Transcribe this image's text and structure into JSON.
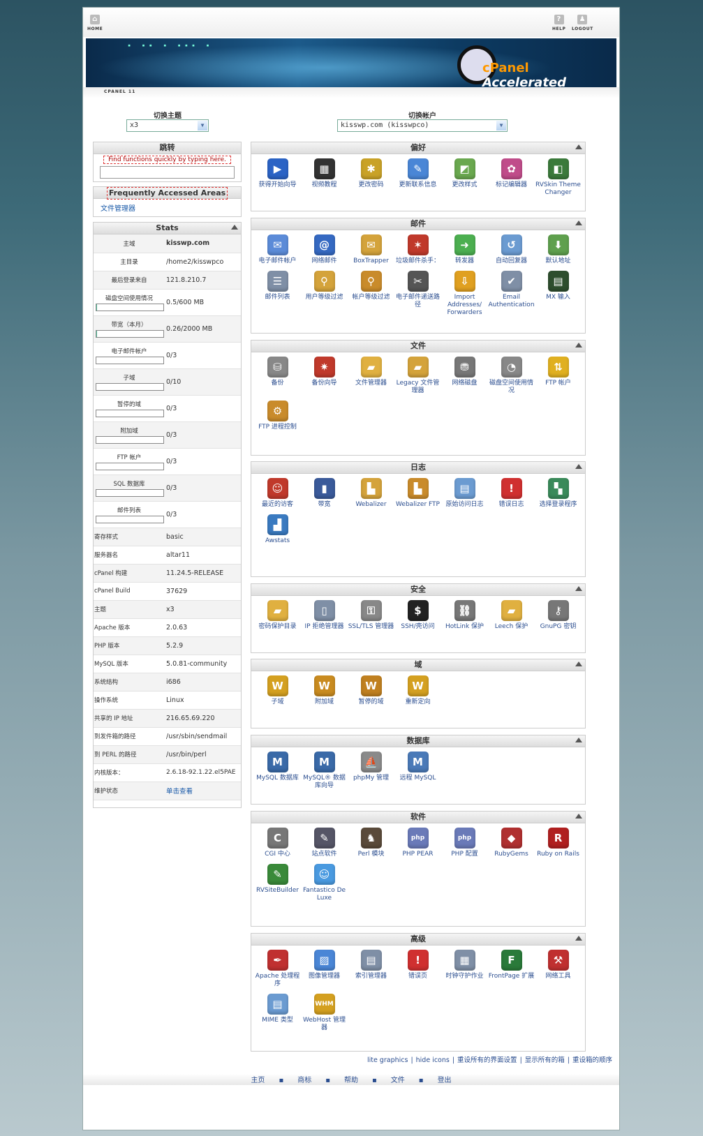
{
  "top": {
    "home": "HOME",
    "help": "HELP",
    "logout": "LOGOUT"
  },
  "banner": {
    "brand": "cPanel",
    "tag": "Accelerated"
  },
  "version": "CPANEL 11",
  "theme": {
    "label": "切换主题",
    "value": "x3"
  },
  "account": {
    "label": "切换帐户",
    "value": "kisswp.com (kisswpco)"
  },
  "jump": {
    "title": "跳转",
    "hint": "Find functions quickly by typing here."
  },
  "faa": {
    "title": "Frequently Accessed Areas",
    "items": [
      "文件管理器"
    ]
  },
  "stats": {
    "title": "Stats",
    "rows": [
      {
        "k": "主域",
        "v": "kisswp.com",
        "bold": true
      },
      {
        "k": "主目录",
        "v": "/home2/kisswpco"
      },
      {
        "k": "最后登录来自",
        "v": "121.8.210.7"
      },
      {
        "k": "磁盘空间使用情况",
        "v": "0.5/600 MB",
        "bar": 0.001
      },
      {
        "k": "带宽（本月）",
        "v": "0.26/2000 MB",
        "bar": 0.001
      },
      {
        "k": "电子邮件帐户",
        "v": "0/3",
        "bar": 0
      },
      {
        "k": "子域",
        "v": "0/10",
        "bar": 0
      },
      {
        "k": "暂停的域",
        "v": "0/3",
        "bar": 0
      },
      {
        "k": "附加域",
        "v": "0/3",
        "bar": 0
      },
      {
        "k": "FTP 帐户",
        "v": "0/3",
        "bar": 0
      },
      {
        "k": "SQL 数据库",
        "v": "0/3",
        "bar": 0
      },
      {
        "k": "邮件列表",
        "v": "0/3",
        "bar": 0
      },
      {
        "k": "寄存样式",
        "v": "basic"
      },
      {
        "k": "服务器名",
        "v": "altar11"
      },
      {
        "k": "cPanel 构建",
        "v": "11.24.5-RELEASE"
      },
      {
        "k": "cPanel Build",
        "v": "37629"
      },
      {
        "k": "主题",
        "v": "x3"
      },
      {
        "k": "Apache 版本",
        "v": "2.0.63"
      },
      {
        "k": "PHP 版本",
        "v": "5.2.9"
      },
      {
        "k": "MySQL 版本",
        "v": "5.0.81-community"
      },
      {
        "k": "系统结构",
        "v": "i686"
      },
      {
        "k": "操作系统",
        "v": "Linux"
      },
      {
        "k": "共享的 IP 地址",
        "v": "216.65.69.220"
      },
      {
        "k": "到发件箱的路径",
        "v": "/usr/sbin/sendmail"
      },
      {
        "k": "到 PERL 的路径",
        "v": "/usr/bin/perl"
      },
      {
        "k": "内核版本：",
        "v": "2.6.18-92.1.22.el5PAE"
      },
      {
        "k": "维护状态",
        "v": "单击查看",
        "link": true
      }
    ]
  },
  "groups": [
    {
      "title": "偏好",
      "items": [
        {
          "label": "获得开始向导",
          "icon": "play-icon",
          "glyph": "▶",
          "color": "#2b63c5"
        },
        {
          "label": "视频教程",
          "icon": "clapper-icon",
          "glyph": "▦",
          "color": "#333"
        },
        {
          "label": "更改密码",
          "icon": "lock-icon",
          "glyph": "✱",
          "color": "#c9a227"
        },
        {
          "label": "更新联系信息",
          "icon": "contact-icon",
          "glyph": "✎",
          "color": "#4a86d6"
        },
        {
          "label": "更改样式",
          "icon": "style-icon",
          "glyph": "◩",
          "color": "#6aa84f"
        },
        {
          "label": "标记编辑器",
          "icon": "palette-icon",
          "glyph": "✿",
          "color": "#c04c8a"
        },
        {
          "label": "RVSkin Theme Changer",
          "icon": "theme-icon",
          "glyph": "◧",
          "color": "#3b7a3b"
        }
      ]
    },
    {
      "title": "邮件",
      "items": [
        {
          "label": "电子邮件帐户",
          "icon": "envelope-icon",
          "glyph": "✉",
          "color": "#5b8bd8"
        },
        {
          "label": "网络邮件",
          "icon": "webmail-icon",
          "glyph": "@",
          "color": "#3569c2"
        },
        {
          "label": "BoxTrapper",
          "icon": "boxtrapper-icon",
          "glyph": "✉",
          "color": "#d4a33b"
        },
        {
          "label": "垃圾邮件杀手：",
          "icon": "spamassassin-icon",
          "glyph": "✶",
          "color": "#c0392b"
        },
        {
          "label": "转发器",
          "icon": "forwarder-icon",
          "glyph": "➜",
          "color": "#4caf50"
        },
        {
          "label": "自动回复器",
          "icon": "autoresponder-icon",
          "glyph": "↺",
          "color": "#6b9bd1"
        },
        {
          "label": "默认地址",
          "icon": "default-address-icon",
          "glyph": "⬇",
          "color": "#5fa04e"
        },
        {
          "label": "邮件列表",
          "icon": "mailing-list-icon",
          "glyph": "☰",
          "color": "#7f8fa6"
        },
        {
          "label": "用户等级过滤",
          "icon": "user-filter-icon",
          "glyph": "⚲",
          "color": "#d4a33b"
        },
        {
          "label": "帐户等级过滤",
          "icon": "account-filter-icon",
          "glyph": "⚲",
          "color": "#c98b2b"
        },
        {
          "label": "电子邮件递送路径",
          "icon": "trace-icon",
          "glyph": "✂",
          "color": "#555"
        },
        {
          "label": "Import Addresses/ Forwarders",
          "icon": "import-icon",
          "glyph": "⇩",
          "color": "#e0a020"
        },
        {
          "label": "Email Authentication",
          "icon": "auth-icon",
          "glyph": "✔",
          "color": "#7f8fa6"
        },
        {
          "label": "MX 输入",
          "icon": "mx-icon",
          "glyph": "▤",
          "color": "#2e4e2e"
        }
      ]
    },
    {
      "title": "文件",
      "items": [
        {
          "label": "备份",
          "icon": "backup-icon",
          "glyph": "⛁",
          "color": "#888"
        },
        {
          "label": "备份向导",
          "icon": "backup-wizard-icon",
          "glyph": "✷",
          "color": "#c0392b"
        },
        {
          "label": "文件管理器",
          "icon": "folder-icon",
          "glyph": "▰",
          "color": "#e0b040"
        },
        {
          "label": "Legacy 文件管理器",
          "icon": "legacy-folder-icon",
          "glyph": "▰",
          "color": "#d4a33b"
        },
        {
          "label": "网络磁盘",
          "icon": "network-disk-icon",
          "glyph": "⛃",
          "color": "#777"
        },
        {
          "label": "磁盘空间使用情况",
          "icon": "disk-usage-icon",
          "glyph": "◔",
          "color": "#888"
        },
        {
          "label": "FTP 帐户",
          "icon": "ftp-icon",
          "glyph": "⇅",
          "color": "#e0b020"
        },
        {
          "label": "FTP 进程控制",
          "icon": "ftp-session-icon",
          "glyph": "⚙",
          "color": "#c98b2b"
        }
      ]
    },
    {
      "title": "日志",
      "items": [
        {
          "label": "最近的访客",
          "icon": "visitors-icon",
          "glyph": "☺",
          "color": "#c0392b"
        },
        {
          "label": "带宽",
          "icon": "bandwidth-icon",
          "glyph": "▮",
          "color": "#3a5a9a"
        },
        {
          "label": "Webalizer",
          "icon": "webalizer-icon",
          "glyph": "▙",
          "color": "#d4a33b"
        },
        {
          "label": "Webalizer FTP",
          "icon": "webalizer-ftp-icon",
          "glyph": "▙",
          "color": "#c98b2b"
        },
        {
          "label": "原始访问日志",
          "icon": "raw-log-icon",
          "glyph": "▤",
          "color": "#6b9bd1"
        },
        {
          "label": "错误日志",
          "icon": "error-log-icon",
          "glyph": "!",
          "color": "#d03030"
        },
        {
          "label": "选择登录程序",
          "icon": "choose-log-icon",
          "glyph": "▚",
          "color": "#3a8a5a"
        },
        {
          "label": "Awstats",
          "icon": "awstats-icon",
          "glyph": "▟",
          "color": "#3a7ac0"
        }
      ]
    },
    {
      "title": "安全",
      "items": [
        {
          "label": "密码保护目录",
          "icon": "protected-dir-icon",
          "glyph": "▰",
          "color": "#e0b040"
        },
        {
          "label": "IP 拒绝管理器",
          "icon": "ip-deny-icon",
          "glyph": "▯",
          "color": "#7f8fa6"
        },
        {
          "label": "SSL/TLS 管理器",
          "icon": "ssl-icon",
          "glyph": "⚿",
          "color": "#888"
        },
        {
          "label": "SSH/壳访问",
          "icon": "ssh-icon",
          "glyph": "$",
          "color": "#222"
        },
        {
          "label": "HotLink 保护",
          "icon": "hotlink-icon",
          "glyph": "⛓",
          "color": "#777"
        },
        {
          "label": "Leech 保护",
          "icon": "leech-icon",
          "glyph": "▰",
          "color": "#e0b040"
        },
        {
          "label": "GnuPG 密钥",
          "icon": "key-icon",
          "glyph": "⚷",
          "color": "#777"
        }
      ]
    },
    {
      "title": "域",
      "items": [
        {
          "label": "子域",
          "icon": "subdomain-icon",
          "glyph": "W",
          "color": "#d4a020"
        },
        {
          "label": "附加域",
          "icon": "addon-domain-icon",
          "glyph": "W",
          "color": "#c98b20"
        },
        {
          "label": "暂停的域",
          "icon": "parked-domain-icon",
          "glyph": "W",
          "color": "#c08020"
        },
        {
          "label": "重新定向",
          "icon": "redirect-icon",
          "glyph": "W",
          "color": "#d4a020"
        }
      ]
    },
    {
      "title": "数据库",
      "items": [
        {
          "label": "MySQL 数据库",
          "icon": "mysql-icon",
          "glyph": "M",
          "color": "#3a6aa8"
        },
        {
          "label": "MySQL® 数据库向导",
          "icon": "mysql-wizard-icon",
          "glyph": "M",
          "color": "#3a6aa8"
        },
        {
          "label": "phpMy 管理",
          "icon": "phpmyadmin-icon",
          "glyph": "⛵",
          "color": "#8a8a8a"
        },
        {
          "label": "远程 MySQL",
          "icon": "remote-mysql-icon",
          "glyph": "M",
          "color": "#4a7ab8"
        }
      ]
    },
    {
      "title": "软件",
      "items": [
        {
          "label": "CGI 中心",
          "icon": "cgi-icon",
          "glyph": "C",
          "color": "#777"
        },
        {
          "label": "站点软件",
          "icon": "site-software-icon",
          "glyph": "✎",
          "color": "#556"
        },
        {
          "label": "Perl 模块",
          "icon": "camel-icon",
          "glyph": "♞",
          "color": "#5a4a3a"
        },
        {
          "label": "PHP PEAR",
          "icon": "php-pear-icon",
          "glyph": "php",
          "color": "#6a7ab8"
        },
        {
          "label": "PHP 配置",
          "icon": "php-config-icon",
          "glyph": "php",
          "color": "#6a7ab8"
        },
        {
          "label": "RubyGems",
          "icon": "rubygems-icon",
          "glyph": "◆",
          "color": "#b03030"
        },
        {
          "label": "Ruby on Rails",
          "icon": "rails-icon",
          "glyph": "R",
          "color": "#b02020"
        },
        {
          "label": "RVSiteBuilder",
          "icon": "sitebuilder-icon",
          "glyph": "✎",
          "color": "#3a8a3a"
        },
        {
          "label": "Fantastico De Luxe",
          "icon": "fantastico-icon",
          "glyph": "☺",
          "color": "#4a9ae0"
        }
      ]
    },
    {
      "title": "高级",
      "items": [
        {
          "label": "Apache 处理程序",
          "icon": "apache-icon",
          "glyph": "✒",
          "color": "#c03030"
        },
        {
          "label": "图像管理器",
          "icon": "image-manager-icon",
          "glyph": "▨",
          "color": "#4a86d6"
        },
        {
          "label": "索引管理器",
          "icon": "index-manager-icon",
          "glyph": "▤",
          "color": "#7f8fa6"
        },
        {
          "label": "错误页",
          "icon": "error-page-icon",
          "glyph": "!",
          "color": "#d03030"
        },
        {
          "label": "时钟守护作业",
          "icon": "cron-icon",
          "glyph": "▦",
          "color": "#7f8fa6"
        },
        {
          "label": "FrontPage 扩展",
          "icon": "frontpage-icon",
          "glyph": "F",
          "color": "#2a7a3a"
        },
        {
          "label": "网络工具",
          "icon": "network-tools-icon",
          "glyph": "⚒",
          "color": "#c03030"
        },
        {
          "label": "MIME 类型",
          "icon": "mime-icon",
          "glyph": "▤",
          "color": "#6b9bd1"
        },
        {
          "label": "WebHost 管理器",
          "icon": "whm-icon",
          "glyph": "WHM",
          "color": "#d4a020"
        }
      ]
    }
  ],
  "footlinks": [
    "lite graphics",
    "hide icons",
    "重设所有的界面设置",
    "显示所有的箱",
    "重设箱的顺序"
  ],
  "bottomnav": [
    "主页",
    "商标",
    "帮助",
    "文件",
    "登出"
  ]
}
